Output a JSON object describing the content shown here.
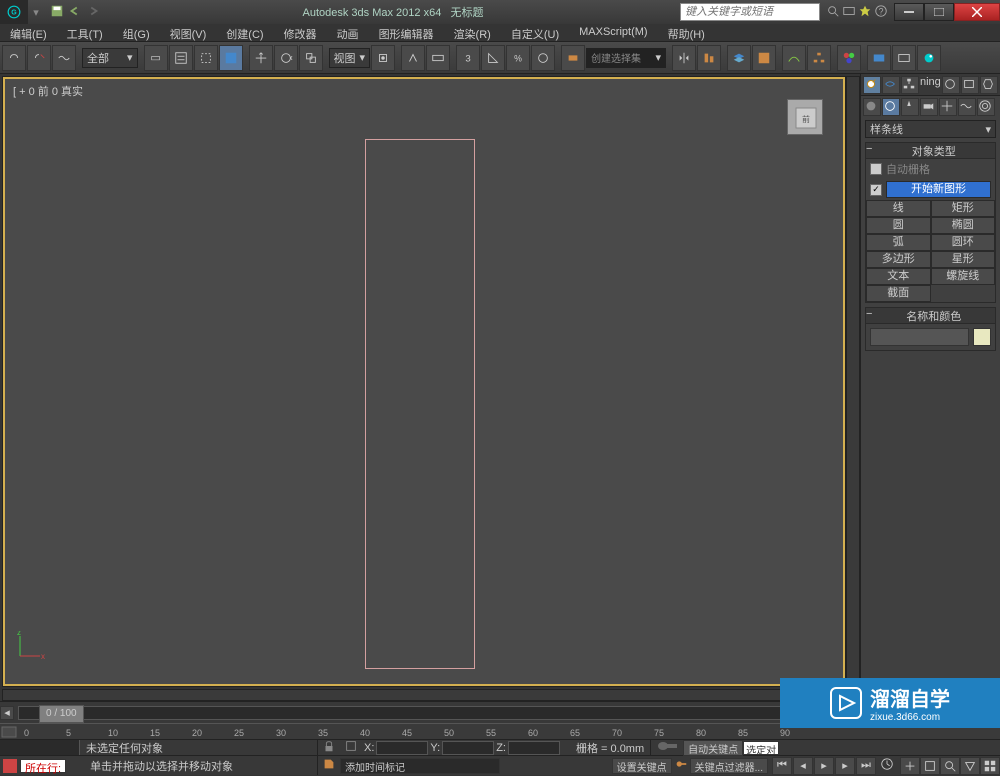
{
  "title": {
    "app": "Autodesk 3ds Max  2012 x64",
    "doc": "无标题"
  },
  "search": {
    "placeholder": "键入关键字或短语"
  },
  "menus": [
    "编辑(E)",
    "工具(T)",
    "组(G)",
    "视图(V)",
    "创建(C)",
    "修改器",
    "动画",
    "图形编辑器",
    "渲染(R)",
    "自定义(U)",
    "MAXScript(M)",
    "帮助(H)"
  ],
  "toolbar": {
    "filter": "全部",
    "view_btn": "视图",
    "selectionset_placeholder": "创建选择集"
  },
  "viewport": {
    "label": "[ + 0 前 0 真实"
  },
  "panel": {
    "dropdown": "样条线",
    "section_objtype": "对象类型",
    "checkbox_autogrid": "自动栅格",
    "checkbox_startnew": "开始新图形",
    "buttons": [
      [
        "线",
        "矩形"
      ],
      [
        "圆",
        "椭圆"
      ],
      [
        "弧",
        "圆环"
      ],
      [
        "多边形",
        "星形"
      ],
      [
        "文本",
        "螺旋线"
      ],
      [
        "截面",
        ""
      ]
    ],
    "section_namecolor": "名称和颜色"
  },
  "timeline": {
    "frame": "0 / 100"
  },
  "ruler": {
    "ticks": [
      "0",
      "5",
      "10",
      "15",
      "20",
      "25",
      "30",
      "35",
      "40",
      "45",
      "50",
      "55",
      "60",
      "65",
      "70",
      "75",
      "80",
      "85",
      "90"
    ]
  },
  "status": {
    "selection": "未选定任何对象",
    "hint": "单击并拖动以选择并移动对象",
    "location_label": "所在行:",
    "grid": "栅格 = 0.0mm",
    "add_time_tag": "添加时间标记",
    "autokey": "自动关键点",
    "setkey": "设置关键点",
    "selected_obj": "选定对象",
    "keyfilter": "关键点过滤器...",
    "x": "X:",
    "y": "Y:",
    "z": "Z:"
  },
  "watermark": {
    "brand": "溜溜自学",
    "url": "zixue.3d66.com"
  }
}
